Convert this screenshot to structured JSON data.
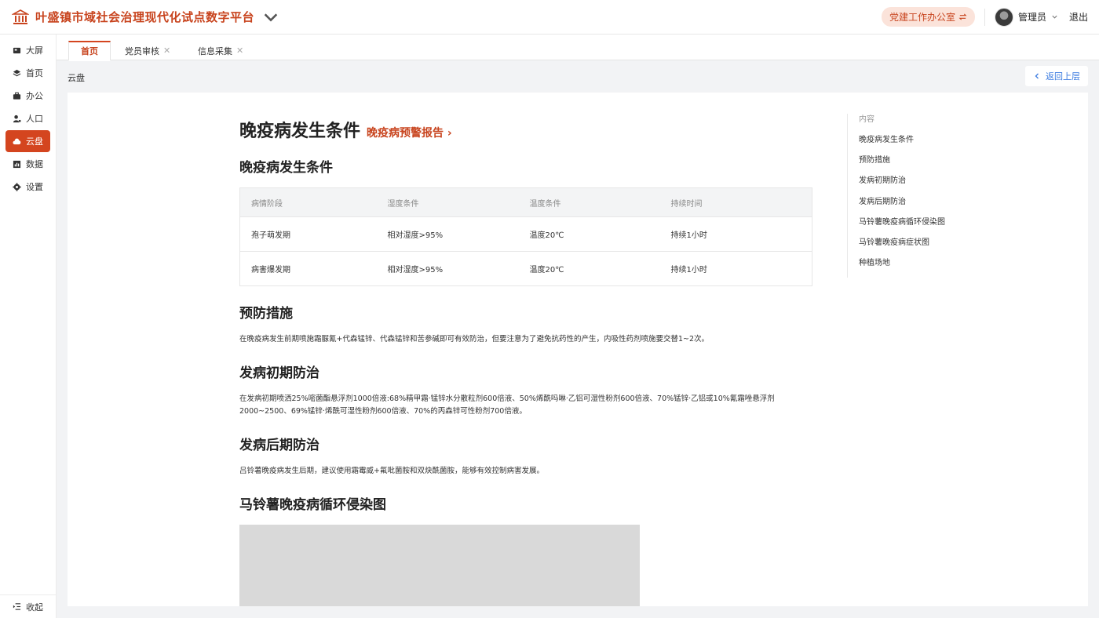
{
  "header": {
    "title": "叶盛镇市域社会治理现代化试点数字平台",
    "office": "党建工作办公室",
    "user": "管理员",
    "logout": "退出"
  },
  "sidebar": {
    "items": [
      {
        "label": "大屏",
        "icon": "screen-icon"
      },
      {
        "label": "首页",
        "icon": "layers-icon"
      },
      {
        "label": "办公",
        "icon": "briefcase-icon"
      },
      {
        "label": "人口",
        "icon": "person-icon"
      },
      {
        "label": "云盘",
        "icon": "cloud-icon"
      },
      {
        "label": "数据",
        "icon": "chart-icon"
      },
      {
        "label": "设置",
        "icon": "gear-icon"
      }
    ],
    "collapse": "收起"
  },
  "tabs": [
    {
      "label": "首页",
      "closable": false
    },
    {
      "label": "党员审核",
      "closable": true
    },
    {
      "label": "信息采集",
      "closable": true
    }
  ],
  "breadcrumb": "云盘",
  "back": "返回上层",
  "article": {
    "title": "晚疫病发生条件",
    "report_link": "晚疫病预警报告",
    "sec1": "晚疫病发生条件",
    "table": {
      "headers": [
        "病情阶段",
        "湿度条件",
        "温度条件",
        "持续时间"
      ],
      "rows": [
        [
          "孢子萌发期",
          "相对湿度>95%",
          "温度20℃",
          "持续1小时"
        ],
        [
          "病害爆发期",
          "相对湿度>95%",
          "温度20℃",
          "持续1小时"
        ]
      ]
    },
    "sec2": "预防措施",
    "p2": "在晚疫病发生前期喷施霜脲氰+代森锰锌、代森锰锌和苦参碱即可有效防治，但要注意为了避免抗药性的产生，内吸性药剂喷施要交替1~2次。",
    "sec3": "发病初期防治",
    "p3": "在发病初期喷洒25%嘧菌酯悬浮剂1000倍液:68%精甲霜·锰锌水分散粒剂600倍液、50%烯酰吗啉·乙铝可湿性粉剂600倍液、70%锰锌·乙铝或10%氰霜唑悬浮剂2000~2500、69%锰锌·烯酰可湿性粉剂600倍液、70%的丙森锌可性粉剂700倍液。",
    "sec4": "发病后期防治",
    "p4": "吕铃薯晚疫病发生后期，建议使用霜霉威+氟吡菌胺和双炔酰菌胺，能够有效控制病害发展。",
    "sec5": "马铃薯晚疫病循环侵染图"
  },
  "toc": {
    "head": "内容",
    "items": [
      "晚疫病发生条件",
      "预防措施",
      "发病初期防治",
      "发病后期防治",
      "马铃薯晚疫病循环侵染图",
      "马铃薯晚疫病症状图",
      "种植场地"
    ]
  },
  "colors": {
    "accent": "#d4451f",
    "link": "#3b7be0",
    "pill_bg": "#fbe3da"
  }
}
